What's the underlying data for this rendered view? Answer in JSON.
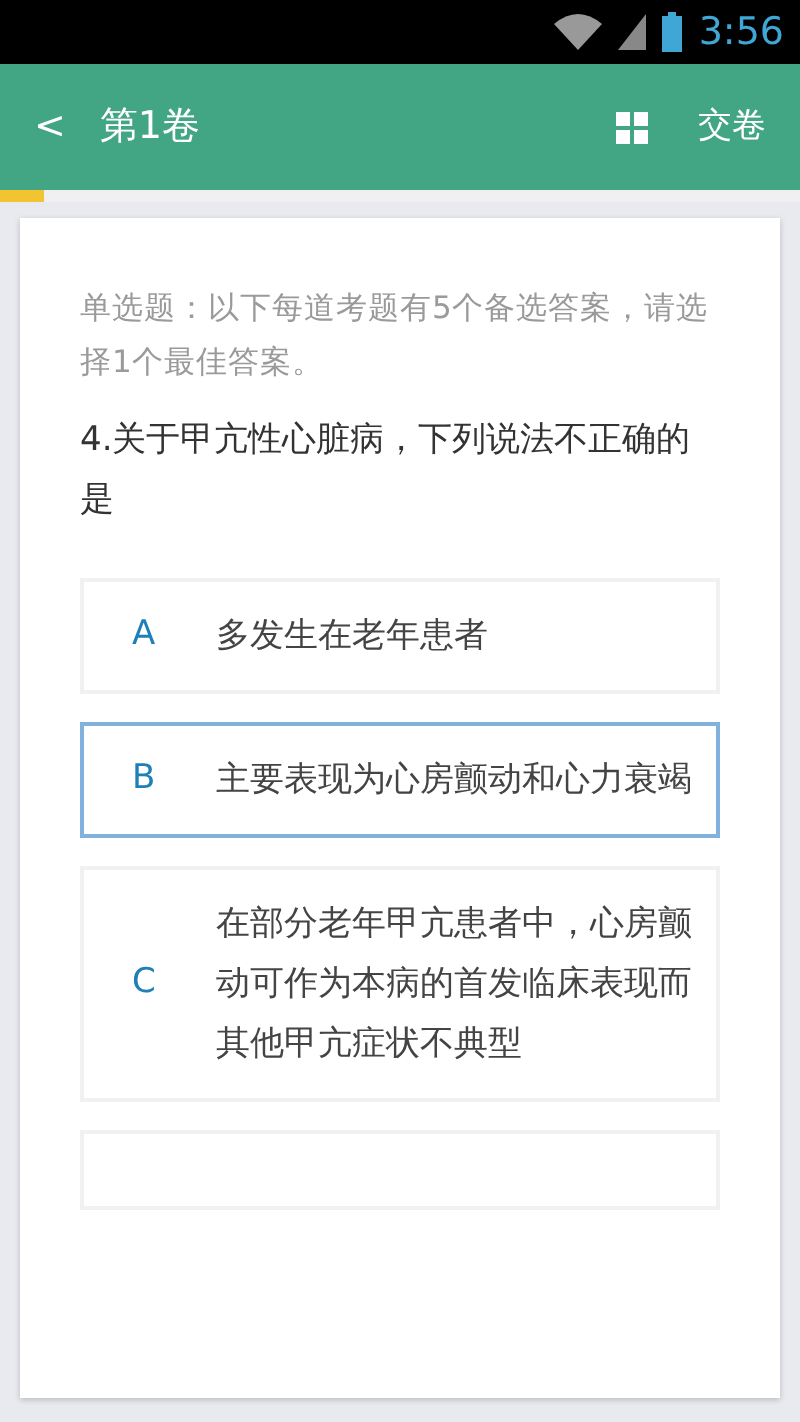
{
  "status_bar": {
    "time": "3:56"
  },
  "app_bar": {
    "back": "<",
    "title": "第1卷",
    "submit": "交卷"
  },
  "progress": {
    "level": 0.055
  },
  "question": {
    "instruction": "单选题：以下每道考题有5个备选答案，请选择1个最佳答案。",
    "text": "4.关于甲亢性心脏病，下列说法不正确的是",
    "options": [
      {
        "letter": "A",
        "text": "多发生在老年患者",
        "selected": false
      },
      {
        "letter": "B",
        "text": "主要表现为心房颤动和心力衰竭",
        "selected": true
      },
      {
        "letter": "C",
        "text": "在部分老年甲亢患者中，心房颤动可作为本病的首发临床表现而其他甲亢症状不典型",
        "selected": false
      }
    ]
  }
}
